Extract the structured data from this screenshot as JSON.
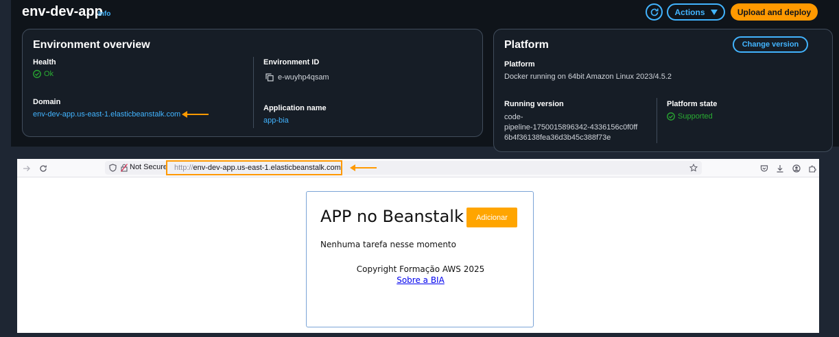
{
  "console": {
    "env_title": "env-dev-app",
    "info_label": "Info",
    "actions_label": "Actions",
    "upload_label": "Upload and deploy"
  },
  "overview": {
    "heading": "Environment overview",
    "health_label": "Health",
    "health_value": "Ok",
    "domain_label": "Domain",
    "domain_value": "env-dev-app.us-east-1.elasticbeanstalk.com",
    "env_id_label": "Environment ID",
    "env_id_value": "e-wuyhp4qsam",
    "app_name_label": "Application name",
    "app_name_value": "app-bia"
  },
  "platform": {
    "heading": "Platform",
    "change_version_label": "Change version",
    "platform_label": "Platform",
    "platform_value": "Docker running on 64bit Amazon Linux 2023/4.5.2",
    "running_version_label": "Running version",
    "running_version_lines": [
      "code-",
      "pipeline-1750015896342-4336156c0f0ff",
      "6b4f36138fea36d3b45c388f73e"
    ],
    "state_label": "Platform state",
    "state_value": "Supported"
  },
  "browser": {
    "not_secure": "Not Secure",
    "url_scheme": "http://",
    "url_host": "env-dev-app.us-east-1.elasticbeanstalk.com"
  },
  "app": {
    "title": "APP no Beanstalk",
    "add_button": "Adicionar",
    "empty_message": "Nenhuma tarefa nesse momento",
    "copyright": "Copyright Formação AWS 2025",
    "about_link": "Sobre a BIA"
  },
  "colors": {
    "accent_blue": "#42b4ff",
    "aws_orange": "#ff9900",
    "success_green": "#29ad32",
    "annotation_arrow": "#ff9900"
  },
  "icons": [
    "refresh-icon",
    "caret-down-icon",
    "check-circle-icon",
    "copy-icon",
    "forward-icon",
    "reload-icon",
    "shield-icon",
    "lock-warning-icon",
    "star-icon",
    "pocket-icon",
    "download-icon",
    "account-icon",
    "extensions-icon",
    "arrow-left-icon"
  ]
}
